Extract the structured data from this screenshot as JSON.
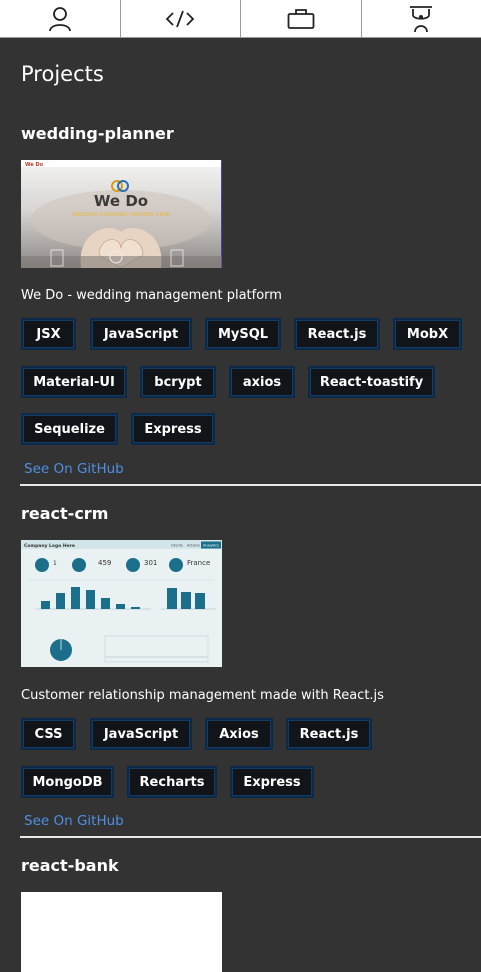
{
  "nav": {
    "items": [
      {
        "icon": "user-icon"
      },
      {
        "icon": "code-icon"
      },
      {
        "icon": "briefcase-icon"
      },
      {
        "icon": "graduation-icon"
      }
    ]
  },
  "section_title": "Projects",
  "projects": [
    {
      "title": "wedding-planner",
      "description": "We Do - wedding management platform",
      "thumbnail": {
        "logo_text": "We Do",
        "tagline": "WEDDING PLANNING HAPPENS HERE",
        "brand": "We Do"
      },
      "tags": [
        "JSX",
        "JavaScript",
        "MySQL",
        "React.js",
        "MobX",
        "Material-UI",
        "bcrypt",
        "axios",
        "React-toastify",
        "Sequelize",
        "Express"
      ],
      "link": "See On GitHub"
    },
    {
      "title": "react-crm",
      "description": "Customer relationship management made with React.js",
      "thumbnail": {
        "header": "Company Logo Here",
        "tabs": [
          "Clients",
          "Actions",
          "Analytics"
        ],
        "stat1": "1",
        "stat2": "459",
        "stat3": "301",
        "stat4": "France"
      },
      "tags": [
        "CSS",
        "JavaScript",
        "Axios",
        "React.js",
        "MongoDB",
        "Recharts",
        "Express"
      ],
      "link": "See On GitHub"
    },
    {
      "title": "react-bank"
    }
  ],
  "colors": {
    "background": "#333333",
    "tag_bg": "#111418",
    "tag_border": "#0b2a4a",
    "link": "#4d8fe0",
    "divider": "#e8e8e8"
  }
}
